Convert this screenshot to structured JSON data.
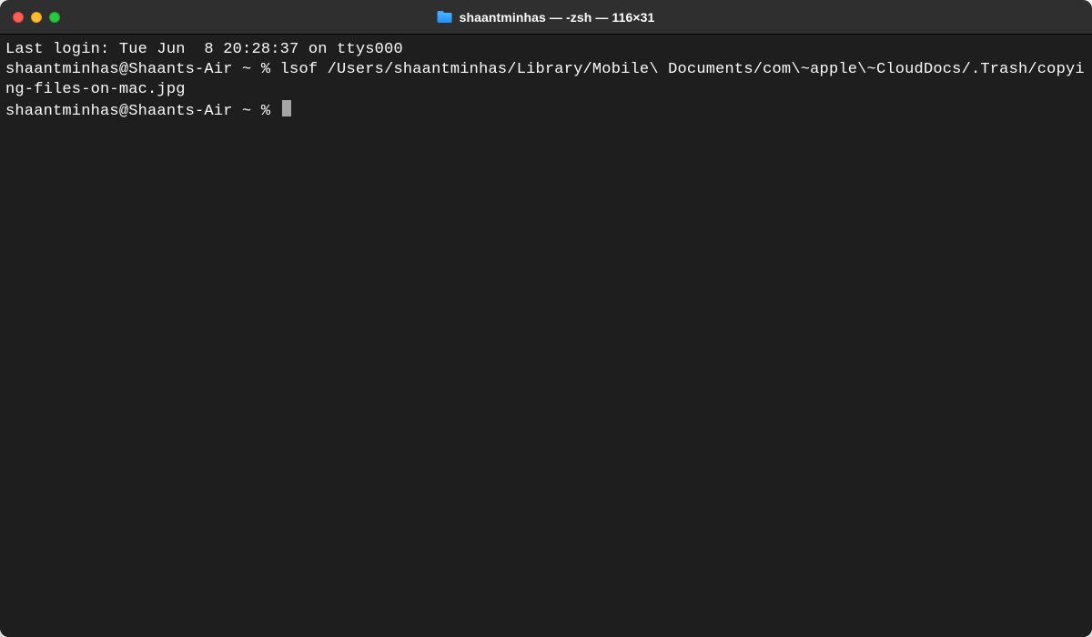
{
  "titlebar": {
    "title": "shaantminhas — -zsh — 116×31"
  },
  "terminal": {
    "lines": [
      "Last login: Tue Jun  8 20:28:37 on ttys000",
      "shaantminhas@Shaants-Air ~ % lsof /Users/shaantminhas/Library/Mobile\\ Documents/com\\~apple\\~CloudDocs/.Trash/copying-files-on-mac.jpg"
    ],
    "current_prompt": "shaantminhas@Shaants-Air ~ % "
  }
}
